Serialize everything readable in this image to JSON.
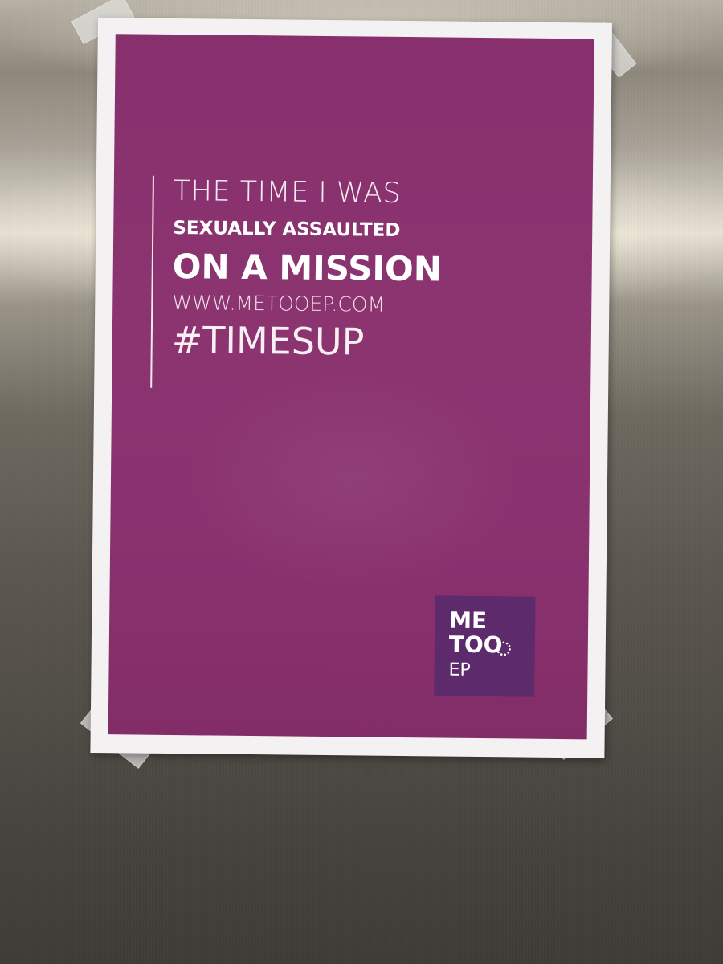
{
  "poster": {
    "line_1": "THE TIME I WAS",
    "line_2": "SEXUALLY ASSAULTED",
    "line_3": "ON A MISSION",
    "line_4": "WWW.METOOEP.COM",
    "line_5": "#TIMESUP"
  },
  "logo": {
    "me": "ME",
    "too": "TOO",
    "ep": "EP"
  },
  "colors": {
    "poster_purple": "#88306d",
    "logo_purple": "#5d2a6b",
    "text": "#ffffff"
  }
}
